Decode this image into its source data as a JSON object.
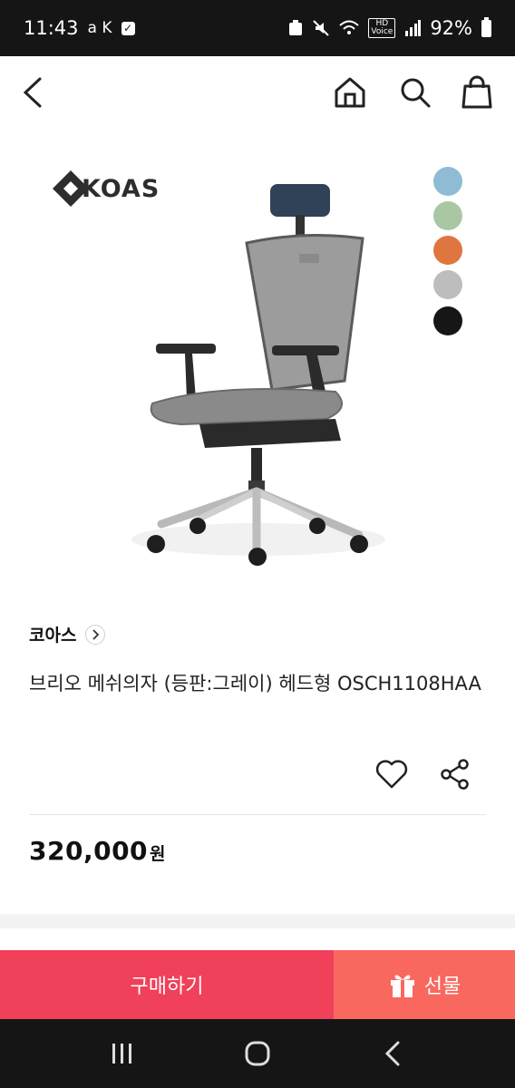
{
  "status_bar": {
    "time": "11:43",
    "carrier_icons": "a K",
    "battery_percent": "92%",
    "hd_top": "HD",
    "hd_bottom": "Voice"
  },
  "top_nav": {
    "icons": [
      "back-icon",
      "home-icon",
      "search-icon",
      "shopping-bag-icon"
    ]
  },
  "hero": {
    "logo_text": "KOAS",
    "color_swatches": [
      "#8fbcd4",
      "#a9c7a3",
      "#e0763f",
      "#bdbdbd",
      "#161616"
    ]
  },
  "product": {
    "brand": "코아스",
    "title": "브리오 메쉬의자 (등판:그레이) 헤드형 OSCH1108HAA",
    "price": "320,000",
    "price_unit": "원"
  },
  "bottom_bar": {
    "buy_label": "구매하기",
    "gift_label": "선물",
    "buy_color": "#f0405a",
    "gift_color": "#f9685f"
  },
  "system_nav": {
    "icons": [
      "recent-apps-icon",
      "home-circle-icon",
      "back-chevron-icon"
    ]
  }
}
